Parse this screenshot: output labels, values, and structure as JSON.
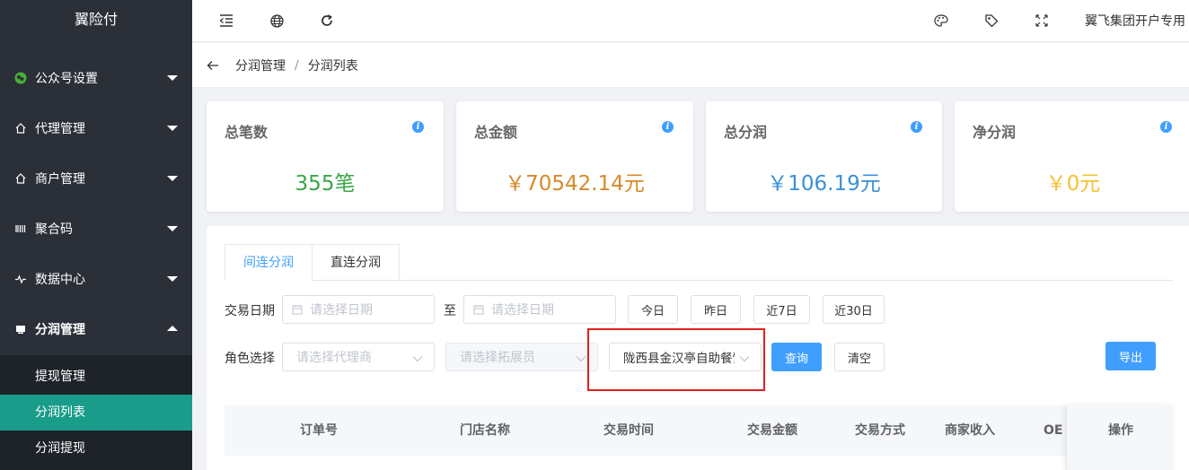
{
  "app": {
    "title": "翼险付"
  },
  "sidebar": {
    "items": [
      {
        "label": "公众号设置",
        "icon": "wechat-icon"
      },
      {
        "label": "代理管理",
        "icon": "home-icon"
      },
      {
        "label": "商户管理",
        "icon": "home-icon"
      },
      {
        "label": "聚合码",
        "icon": "barcode-icon"
      },
      {
        "label": "数据中心",
        "icon": "pulse-icon"
      },
      {
        "label": "分润管理",
        "icon": "monitor-icon"
      }
    ],
    "submenu": [
      {
        "label": "提现管理"
      },
      {
        "label": "分润列表"
      },
      {
        "label": "分润提现"
      }
    ]
  },
  "topbar": {
    "user": "翼飞集团开户专用",
    "icons": [
      "menu-fold-icon",
      "globe-icon",
      "refresh-icon",
      "palette-icon",
      "tag-icon",
      "fullscreen-icon"
    ]
  },
  "breadcrumb": {
    "parent": "分润管理",
    "separator": "/",
    "current": "分润列表"
  },
  "stats": [
    {
      "title": "总笔数",
      "value": "355笔",
      "color": "#3aa548"
    },
    {
      "title": "总金额",
      "value": "￥70542.14元",
      "color": "#d8892a"
    },
    {
      "title": "总分润",
      "value": "￥106.19元",
      "color": "#3c8fd6"
    },
    {
      "title": "净分润",
      "value": "￥0元",
      "color": "#f2c233"
    }
  ],
  "tabs": [
    {
      "label": "间连分润"
    },
    {
      "label": "直连分润"
    }
  ],
  "filters": {
    "date_label": "交易日期",
    "date_start_placeholder": "请选择日期",
    "to_label": "至",
    "date_end_placeholder": "请选择日期",
    "quick_dates": [
      "今日",
      "昨日",
      "近7日",
      "近30日"
    ],
    "role_label": "角色选择",
    "agent_placeholder": "请选择代理商",
    "promoter_placeholder": "请选择拓展员",
    "merchant_value": "陇西县金汉亭自助餐饮",
    "query_label": "查询",
    "clear_label": "清空",
    "export_label": "导出"
  },
  "table": {
    "columns": [
      "订单号",
      "门店名称",
      "交易时间",
      "交易金额",
      "交易方式",
      "商家收入",
      "OE"
    ],
    "action_column": "操作"
  }
}
